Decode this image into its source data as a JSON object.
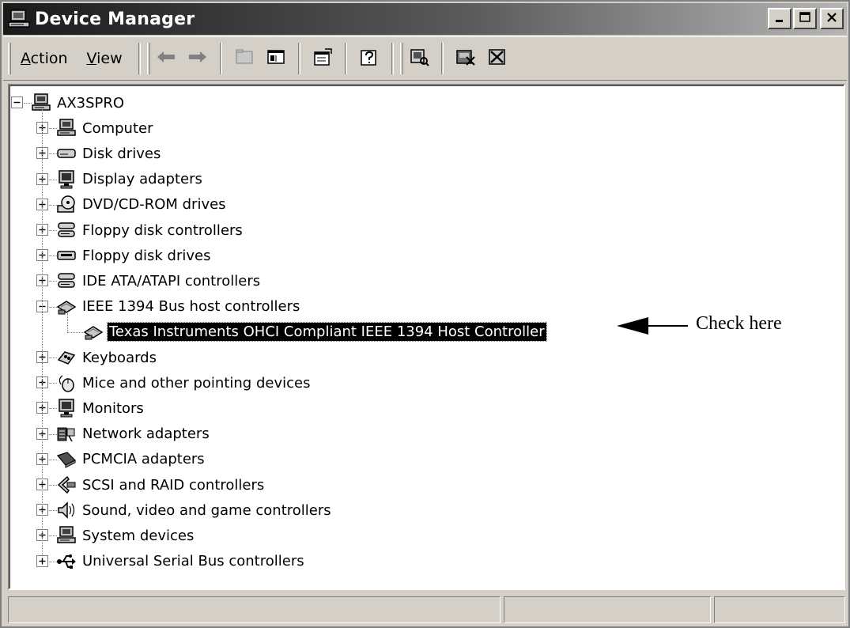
{
  "window": {
    "title": "Device Manager",
    "title_icon": "device-manager-icon",
    "controls": [
      "minimize-icon",
      "restore-icon",
      "close-icon"
    ]
  },
  "toolbar": {
    "menu": [
      {
        "label": "Action",
        "underline": "A",
        "rest": "ction"
      },
      {
        "label": "View",
        "underline": "V",
        "rest": "iew"
      }
    ],
    "buttons": [
      "back-icon",
      "forward-icon",
      "up-folder-icon",
      "show-hide-tree-icon",
      "properties-icon",
      "help-icon",
      "scan-hardware-icon",
      "uninstall-icon",
      "disable-icon"
    ]
  },
  "tree": {
    "root": {
      "label": "AX3SPRO",
      "icon": "computer-icon"
    },
    "items": [
      {
        "label": "Computer",
        "icon": "computer-icon",
        "expanded": false
      },
      {
        "label": "Disk drives",
        "icon": "disk-drive-icon",
        "expanded": false
      },
      {
        "label": "Display adapters",
        "icon": "monitor-icon",
        "expanded": false
      },
      {
        "label": "DVD/CD-ROM drives",
        "icon": "dvd-icon",
        "expanded": false
      },
      {
        "label": "Floppy disk controllers",
        "icon": "controller-icon",
        "expanded": false
      },
      {
        "label": "Floppy disk drives",
        "icon": "floppy-drive-icon",
        "expanded": false
      },
      {
        "label": "IDE ATA/ATAPI controllers",
        "icon": "controller-icon",
        "expanded": false
      },
      {
        "label": "IEEE 1394 Bus host controllers",
        "icon": "ieee1394-icon",
        "expanded": true,
        "children": [
          {
            "label": "Texas Instruments OHCI Compliant IEEE 1394 Host Controller",
            "icon": "ieee1394-icon",
            "selected": true
          }
        ]
      },
      {
        "label": "Keyboards",
        "icon": "keyboard-icon",
        "expanded": false
      },
      {
        "label": "Mice and other pointing devices",
        "icon": "mouse-icon",
        "expanded": false
      },
      {
        "label": "Monitors",
        "icon": "monitor-icon",
        "expanded": false
      },
      {
        "label": "Network adapters",
        "icon": "network-adapter-icon",
        "expanded": false
      },
      {
        "label": "PCMCIA adapters",
        "icon": "pcmcia-icon",
        "expanded": false
      },
      {
        "label": "SCSI and RAID controllers",
        "icon": "scsi-icon",
        "expanded": false
      },
      {
        "label": "Sound, video and game controllers",
        "icon": "sound-icon",
        "expanded": false
      },
      {
        "label": "System devices",
        "icon": "computer-icon",
        "expanded": false
      },
      {
        "label": "Universal Serial Bus controllers",
        "icon": "usb-icon",
        "expanded": false
      }
    ]
  },
  "annotation": {
    "text": "Check here",
    "arrow": "arrow-left-icon"
  },
  "statusbar": {
    "panes": [
      "",
      "",
      ""
    ]
  }
}
